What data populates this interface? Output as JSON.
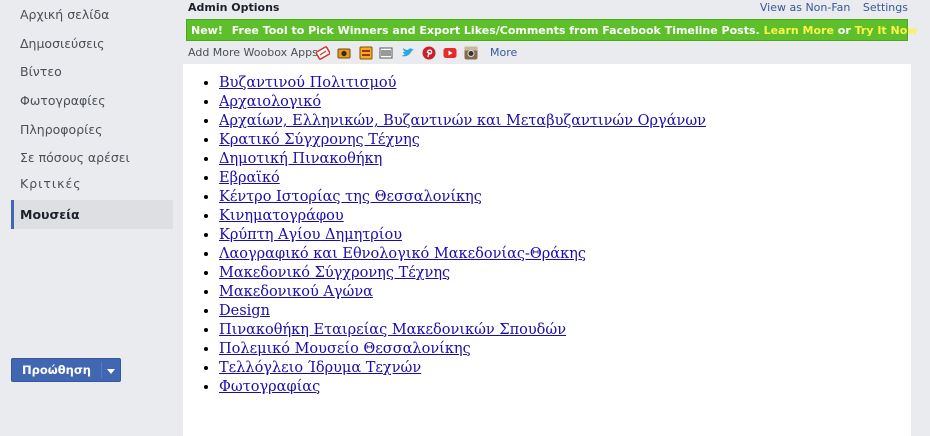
{
  "sidebar": {
    "items": [
      {
        "label": "Αρχική σελίδα"
      },
      {
        "label": "Δημοσιεύσεις"
      },
      {
        "label": "Βίντεο"
      },
      {
        "label": "Φωτογραφίες"
      },
      {
        "label": "Πληροφορίες"
      },
      {
        "label": "Σε πόσους αρέσει"
      },
      {
        "label": "Κριτικές"
      }
    ],
    "active_item": "Μουσεία",
    "promote_button": "Προώθηση"
  },
  "header": {
    "admin_title": "Admin Options",
    "view_as_label": "View as Non-Fan",
    "settings_label": "Settings"
  },
  "promo": {
    "new_label": "New!",
    "message": "Free Tool to Pick Winners and Export Likes/Comments from Facebook Timeline Posts.",
    "learn_more": "Learn More",
    "or": "or",
    "try_it": "Try It Now"
  },
  "apps": {
    "label": "Add More Woobox Apps:",
    "icons": [
      "coupon-icon",
      "camera-icon",
      "contest-icon",
      "form-icon",
      "twitter-icon",
      "pinterest-icon",
      "youtube-icon",
      "instagram-icon"
    ],
    "more": "More"
  },
  "museums": [
    "Βυζαντινού Πολιτισμού",
    "Αρχαιολογικό",
    "Αρχαίων, Ελληνικών, Βυζαντινών και Μεταβυζαντινών Οργάνων",
    "Κρατικό Σύγχρονης Τέχνης",
    "Δημοτική Πινακοθήκη",
    "Εβραϊκό",
    "Κέντρο Ιστορίας της Θεσσαλονίκης",
    "Κινηματογράφου",
    "Κρύπτη Αγίου Δημητρίου",
    "Λαογραφικό και Εθνολογικό Μακεδονίας-Θράκης",
    "Μακεδονικό Σύγχρονης Τέχνης",
    "Μακεδονικού Αγώνα",
    "Design",
    "Πινακοθήκη Εταιρείας Μακεδονικών Σπουδών",
    "Πολεμικό Μουσείο Θεσσαλονίκης",
    "Τελλόγλειο Ίδρυμα Τεχνών",
    "Φωτογραφίας"
  ]
}
